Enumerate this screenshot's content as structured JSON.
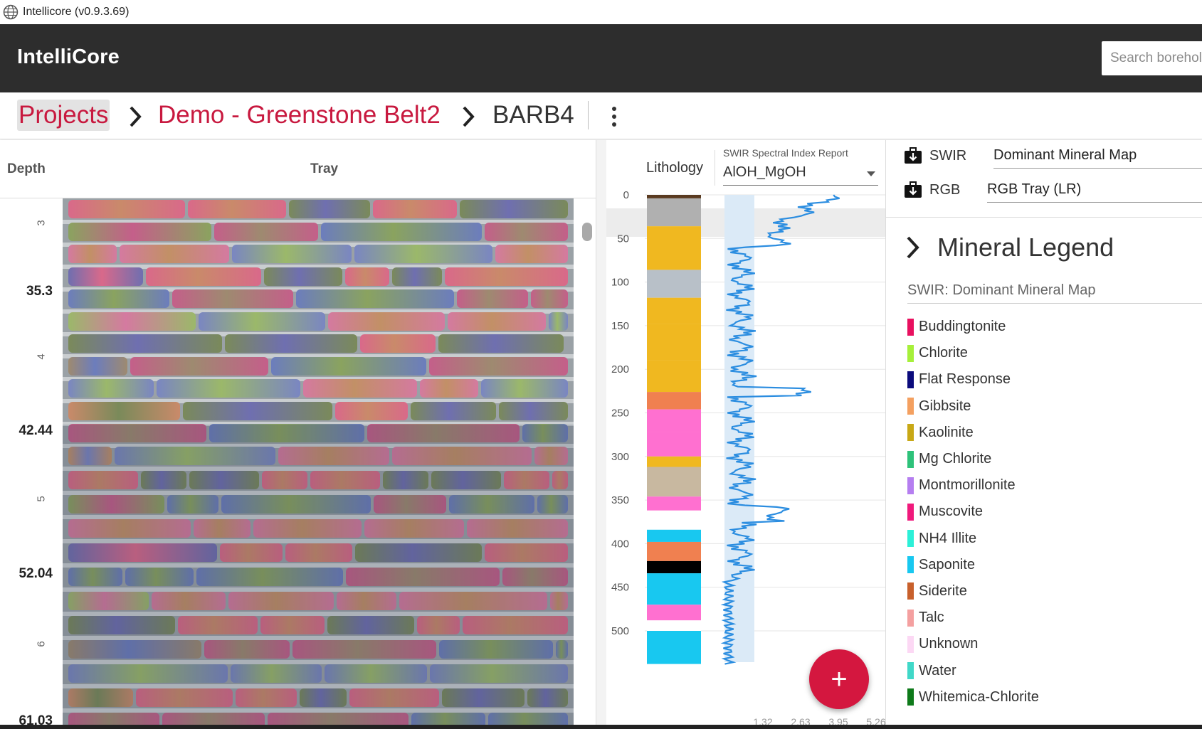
{
  "window": {
    "title": "Intellicore (v0.9.3.69)"
  },
  "appbar": {
    "brand": "IntelliCore",
    "search_placeholder": "Search boreholes"
  },
  "breadcrumb": {
    "projects": "Projects",
    "project": "Demo - Greenstone Belt2",
    "borehole": "BARB4"
  },
  "tray_panel": {
    "depth_header": "Depth",
    "tray_header": "Tray",
    "depth_labels": [
      "35.3",
      "42.44",
      "52.04",
      "61.03"
    ],
    "tray_numbers": [
      "3",
      "4",
      "5",
      "6"
    ]
  },
  "log_panel": {
    "lithology_header": "Lithology",
    "swir_report_label": "SWIR Spectral Index Report",
    "swir_selected": "AlOH_MgOH",
    "depth_ticks": [
      "0",
      "50",
      "100",
      "150",
      "200",
      "250",
      "300",
      "350",
      "400",
      "450",
      "500"
    ],
    "x_ticks": [
      "1.32",
      "2.63",
      "3.95",
      "5.26"
    ]
  },
  "fab": {
    "label": "+"
  },
  "layers": {
    "swir": {
      "name": "SWIR",
      "value": "Dominant Mineral Map"
    },
    "rgb": {
      "name": "RGB",
      "value": "RGB Tray (LR)"
    }
  },
  "mineral_legend": {
    "title": "Mineral Legend",
    "subtitle": "SWIR: Dominant Mineral Map",
    "items": [
      {
        "name": "Buddingtonite",
        "color": "#e8105f"
      },
      {
        "name": "Chlorite",
        "color": "#a6f03a"
      },
      {
        "name": "Flat Response",
        "color": "#0b0b7c"
      },
      {
        "name": "Gibbsite",
        "color": "#f4a060"
      },
      {
        "name": "Kaolinite",
        "color": "#c8a816"
      },
      {
        "name": "Mg Chlorite",
        "color": "#2ec27a"
      },
      {
        "name": "Montmorillonite",
        "color": "#b57ef0"
      },
      {
        "name": "Muscovite",
        "color": "#f01a7c"
      },
      {
        "name": "NH4 Illite",
        "color": "#2cf0d8"
      },
      {
        "name": "Saponite",
        "color": "#18c8f0"
      },
      {
        "name": "Siderite",
        "color": "#c8602c"
      },
      {
        "name": "Talc",
        "color": "#f4a0a0"
      },
      {
        "name": "Unknown",
        "color": "#fcd8f4"
      },
      {
        "name": "Water",
        "color": "#40d8c8"
      },
      {
        "name": "Whitemica-Chlorite",
        "color": "#0e7a1a"
      }
    ]
  }
}
